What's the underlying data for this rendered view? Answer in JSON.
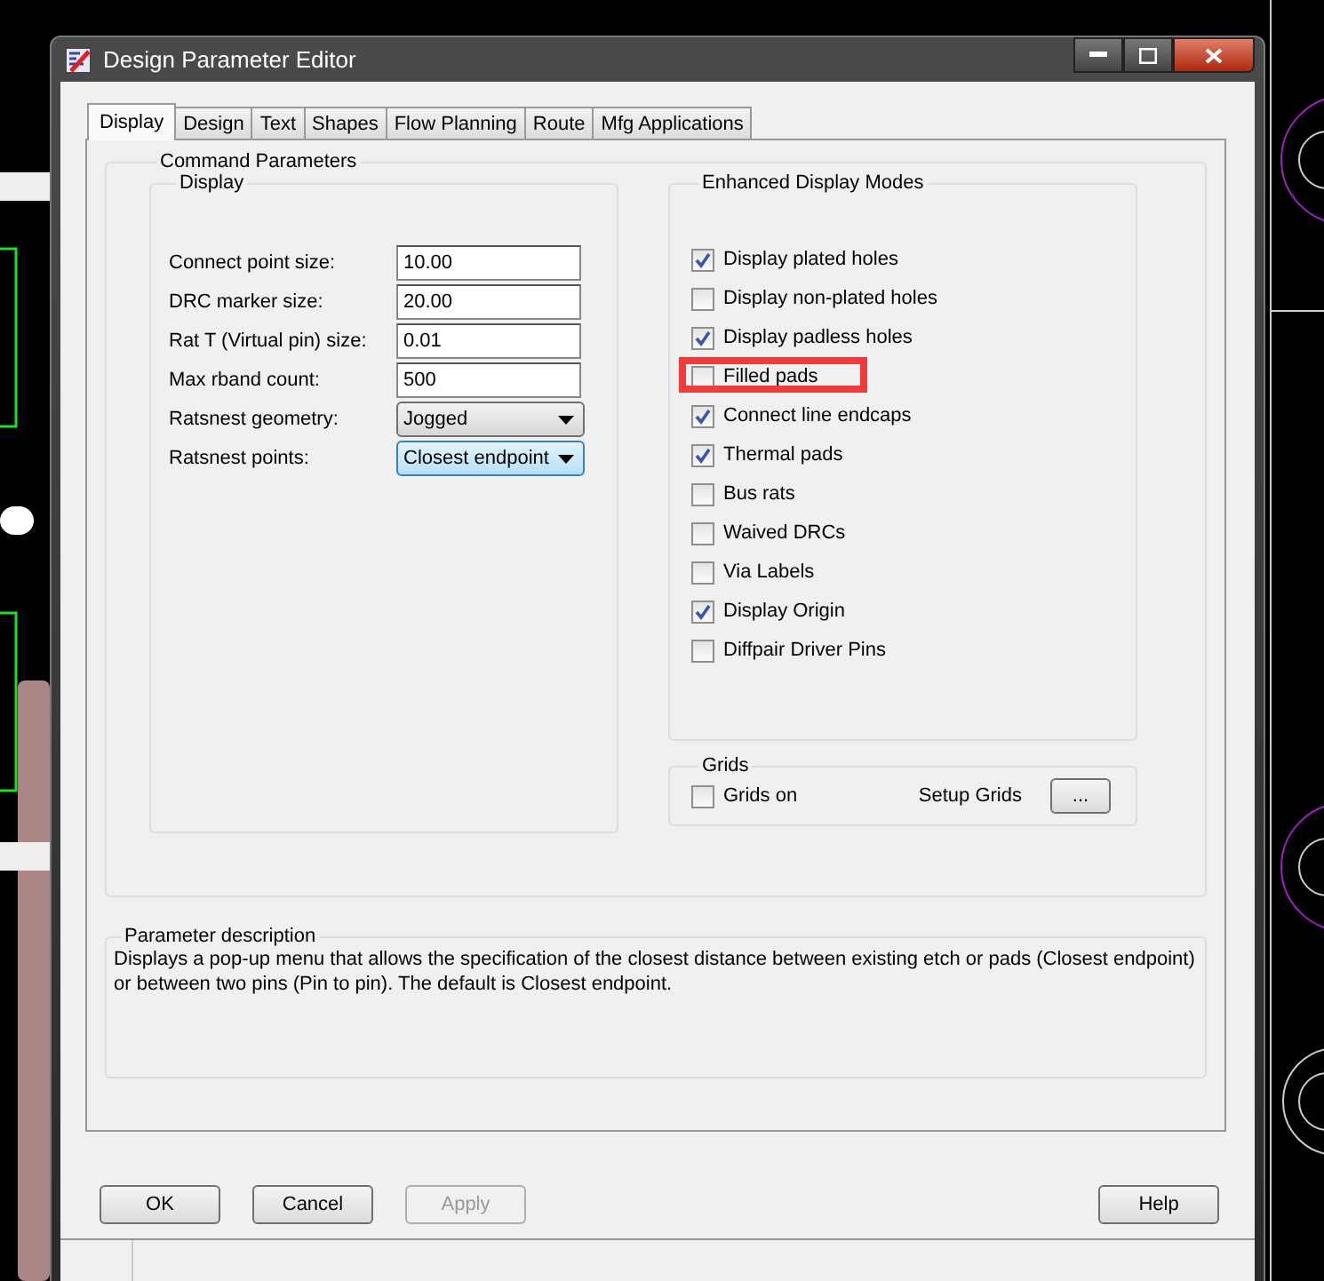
{
  "window": {
    "title": "Design Parameter Editor"
  },
  "tabs": [
    {
      "label": "Display",
      "selected": true
    },
    {
      "label": "Design",
      "selected": false
    },
    {
      "label": "Text",
      "selected": false
    },
    {
      "label": "Shapes",
      "selected": false
    },
    {
      "label": "Flow Planning",
      "selected": false
    },
    {
      "label": "Route",
      "selected": false
    },
    {
      "label": "Mfg Applications",
      "selected": false
    }
  ],
  "command_parameters": {
    "title": "Command Parameters",
    "display": {
      "title": "Display",
      "fields": [
        {
          "kind": "text",
          "label": "Connect point size:",
          "value": "10.00",
          "focused": false
        },
        {
          "kind": "text",
          "label": "DRC marker size:",
          "value": "20.00",
          "focused": false
        },
        {
          "kind": "text",
          "label": "Rat T (Virtual pin) size:",
          "value": "0.01",
          "focused": false
        },
        {
          "kind": "text",
          "label": "Max rband count:",
          "value": "500",
          "focused": false
        },
        {
          "kind": "dropdown",
          "label": "Ratsnest geometry:",
          "value": "Jogged",
          "focused": false
        },
        {
          "kind": "dropdown",
          "label": "Ratsnest points:",
          "value": "Closest endpoint",
          "focused": true
        }
      ]
    },
    "enhanced_display_modes": {
      "title": "Enhanced Display Modes",
      "options": [
        {
          "label": "Display plated holes",
          "checked": true,
          "highlighted": false
        },
        {
          "label": "Display non-plated holes",
          "checked": false,
          "highlighted": false
        },
        {
          "label": "Display padless holes",
          "checked": true,
          "highlighted": false
        },
        {
          "label": "Filled pads",
          "checked": false,
          "highlighted": true
        },
        {
          "label": "Connect line endcaps",
          "checked": true,
          "highlighted": false
        },
        {
          "label": "Thermal pads",
          "checked": true,
          "highlighted": false
        },
        {
          "label": "Bus rats",
          "checked": false,
          "highlighted": false
        },
        {
          "label": "Waived DRCs",
          "checked": false,
          "highlighted": false
        },
        {
          "label": "Via Labels",
          "checked": false,
          "highlighted": false
        },
        {
          "label": "Display Origin",
          "checked": true,
          "highlighted": false
        },
        {
          "label": "Diffpair Driver Pins",
          "checked": false,
          "highlighted": false
        }
      ]
    },
    "grids": {
      "title": "Grids",
      "grids_on": {
        "label": "Grids on",
        "checked": false
      },
      "setup_label": "Setup Grids",
      "setup_button": "..."
    }
  },
  "parameter_description": {
    "title": "Parameter description",
    "text": "Displays a pop-up menu that allows the specification of the closest distance between existing etch or pads (Closest endpoint) or between two pins (Pin to pin). The default is Closest endpoint."
  },
  "buttons": [
    {
      "label": "OK",
      "disabled": false
    },
    {
      "label": "Cancel",
      "disabled": false
    },
    {
      "label": "Apply",
      "disabled": true
    }
  ],
  "help_button": {
    "label": "Help"
  }
}
